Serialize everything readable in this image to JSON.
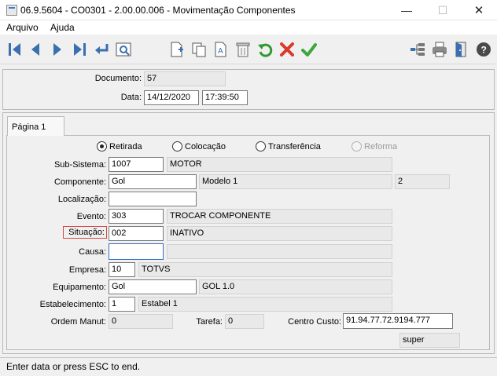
{
  "window": {
    "title": "06.9.5604 - CO0301 - 2.00.00.006 - Movimentação Componentes",
    "minimize": "—",
    "maximize": "☐",
    "close": "✕"
  },
  "menu": {
    "items": [
      "Arquivo",
      "Ajuda"
    ]
  },
  "toolbar": {
    "buttons": [
      "first-icon",
      "previous-icon",
      "next-icon",
      "last-icon",
      "goto-icon",
      "search-icon",
      "new-icon",
      "copy-icon",
      "edit-icon",
      "delete-icon",
      "undo-icon",
      "cancel-icon",
      "save-icon",
      "tree-icon",
      "print-icon",
      "exit-icon",
      "help-icon"
    ]
  },
  "header": {
    "documento_label": "Documento:",
    "documento_value": "57",
    "data_label": "Data:",
    "data_value": "14/12/2020",
    "hora_value": "17:39:50"
  },
  "tab": {
    "label": "Página 1"
  },
  "radios": {
    "retirada": "Retirada",
    "colocacao": "Colocação",
    "transferencia": "Transferência",
    "reforma": "Reforma",
    "selected": "Retirada"
  },
  "form": {
    "subsistema_label": "Sub-Sistema:",
    "subsistema_code": "1007",
    "subsistema_desc": "MOTOR",
    "componente_label": "Componente:",
    "componente_code": "Gol",
    "componente_desc": "Modelo 1",
    "componente_extra": "2",
    "localizacao_label": "Localização:",
    "localizacao_value": "",
    "evento_label": "Evento:",
    "evento_code": "303",
    "evento_desc": "TROCAR COMPONENTE",
    "situacao_label": "Situação:",
    "situacao_code": "002",
    "situacao_desc": "INATIVO",
    "causa_label": "Causa:",
    "causa_code": "",
    "causa_desc": "",
    "empresa_label": "Empresa:",
    "empresa_code": "10",
    "empresa_desc": "TOTVS",
    "equipamento_label": "Equipamento:",
    "equipamento_code": "Gol",
    "equipamento_desc": "GOL 1.0",
    "estabelecimento_label": "Estabelecimento:",
    "estabelecimento_code": "1",
    "estabelecimento_desc": "Estabel 1",
    "ordem_label": "Ordem Manut:",
    "ordem_value": "0",
    "tarefa_label": "Tarefa:",
    "tarefa_value": "0",
    "centro_label": "Centro Custo:",
    "centro_value": "91.94.77.72.9194.777",
    "user_value": "super"
  },
  "status": {
    "text": "Enter data or press ESC to end."
  }
}
